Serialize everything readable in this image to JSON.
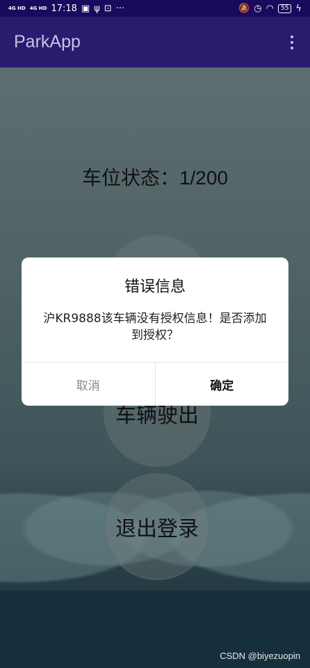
{
  "status_bar": {
    "signal1": "4G HD",
    "signal2": "4G HD",
    "time": "17:18",
    "more": "···",
    "battery": "55"
  },
  "app_bar": {
    "title": "ParkApp"
  },
  "main": {
    "parking_status": "车位状态：1/200",
    "exit_button": "车辆驶出",
    "logout_button": "退出登录"
  },
  "dialog": {
    "title": "错误信息",
    "message": "沪KR9888该车辆没有授权信息！是否添加到授权？",
    "cancel_label": "取消",
    "ok_label": "确定"
  },
  "watermark": "CSDN @biyezuopin"
}
